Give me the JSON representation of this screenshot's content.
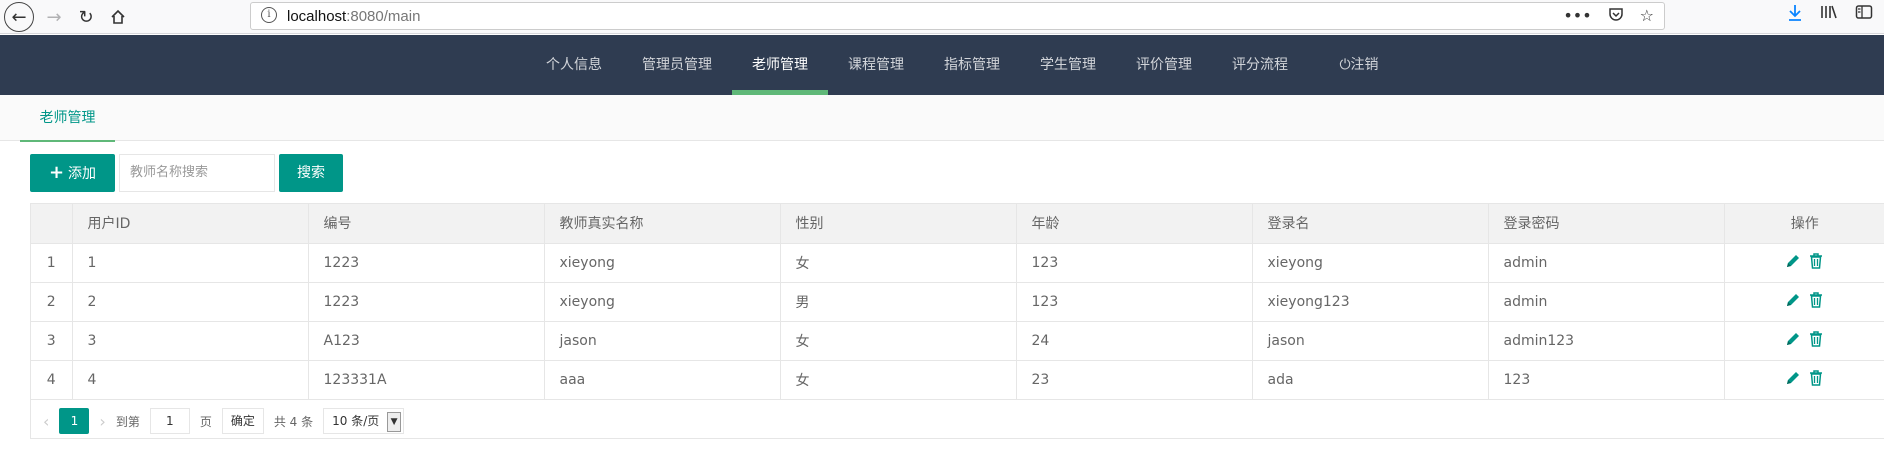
{
  "browser": {
    "url_host": "localhost",
    "url_rest": ":8080/main"
  },
  "nav": {
    "items": [
      "个人信息",
      "管理员管理",
      "老师管理",
      "课程管理",
      "指标管理",
      "学生管理",
      "评价管理",
      "评分流程",
      "注销"
    ],
    "active": "老师管理"
  },
  "tab": {
    "label": "老师管理"
  },
  "toolbar": {
    "add_label": "添加",
    "search_placeholder": "教师名称搜索",
    "search_label": "搜索"
  },
  "table": {
    "headers": [
      "用户ID",
      "编号",
      "教师真实名称",
      "性别",
      "年龄",
      "登录名",
      "登录密码",
      "操作"
    ],
    "rows": [
      {
        "idx": "1",
        "id": "1",
        "code": "1223",
        "name": "xieyong",
        "gender": "女",
        "age": "123",
        "login": "xieyong",
        "password": "admin"
      },
      {
        "idx": "2",
        "id": "2",
        "code": "1223",
        "name": "xieyong",
        "gender": "男",
        "age": "123",
        "login": "xieyong123",
        "password": "admin"
      },
      {
        "idx": "3",
        "id": "3",
        "code": "A123",
        "name": "jason",
        "gender": "女",
        "age": "24",
        "login": "jason",
        "password": "admin123"
      },
      {
        "idx": "4",
        "id": "4",
        "code": "123331A",
        "name": "aaa",
        "gender": "女",
        "age": "23",
        "login": "ada",
        "password": "123"
      }
    ]
  },
  "pager": {
    "current": "1",
    "goto_label": "到第",
    "goto_value": "1",
    "page_label": "页",
    "confirm_label": "确定",
    "total_label": "共 4 条",
    "size_label": "10 条/页"
  },
  "colors": {
    "nav_bg": "#2f3c51",
    "accent": "#009688",
    "nav_active_underline": "#5fb878"
  }
}
